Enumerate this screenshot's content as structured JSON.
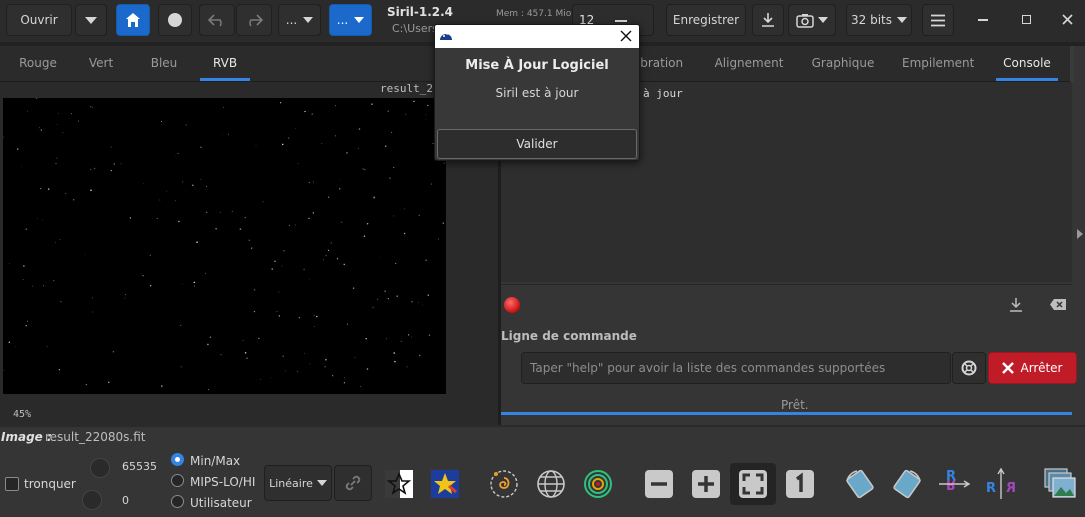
{
  "headerbar": {
    "open_label": "Ouvrir",
    "dropdown1_label": "...",
    "dropdown2_label": "...",
    "app_title": "Siril-1.2.4",
    "path": "C:\\Users",
    "memory": "Mem : 457.1 Mio",
    "spin_value": "12",
    "save_label": "Enregistrer",
    "bits_label": "32 bits"
  },
  "left_tabs": [
    {
      "label": "Rouge"
    },
    {
      "label": "Vert"
    },
    {
      "label": "Bleu"
    },
    {
      "label": "RVB"
    }
  ],
  "right_tabs": [
    {
      "label": "ibration"
    },
    {
      "label": "Alignement"
    },
    {
      "label": "Graphique"
    },
    {
      "label": "Empilement"
    },
    {
      "label": "Console"
    }
  ],
  "image_view": {
    "filename_caption": "result_2",
    "zoom": "45%"
  },
  "console": {
    "log_text": "à jour",
    "command_title": "Ligne de commande",
    "command_placeholder": "Taper \"help\" pour avoir la liste des commandes supportées",
    "stop_label": "Arrêter",
    "status": "Prêt."
  },
  "dialog": {
    "title": "Mise À Jour Logiciel",
    "message": "Siril est à jour",
    "ok_label": "Valider"
  },
  "statusbar": {
    "image_label": "Image :",
    "image_name": "result_22080s.fit"
  },
  "bottom": {
    "clip_label": "tronquer",
    "high_value": "65535",
    "low_value": "0",
    "modes": [
      {
        "label": "Min/Max",
        "selected": true
      },
      {
        "label": "MIPS-LO/HI",
        "selected": false
      },
      {
        "label": "Utilisateur",
        "selected": false
      }
    ],
    "stretch_label": "Linéaire"
  },
  "colors": {
    "accent": "#3584e4",
    "stop_red": "#c01c28",
    "background": "#353535",
    "canvas": "#000000"
  }
}
